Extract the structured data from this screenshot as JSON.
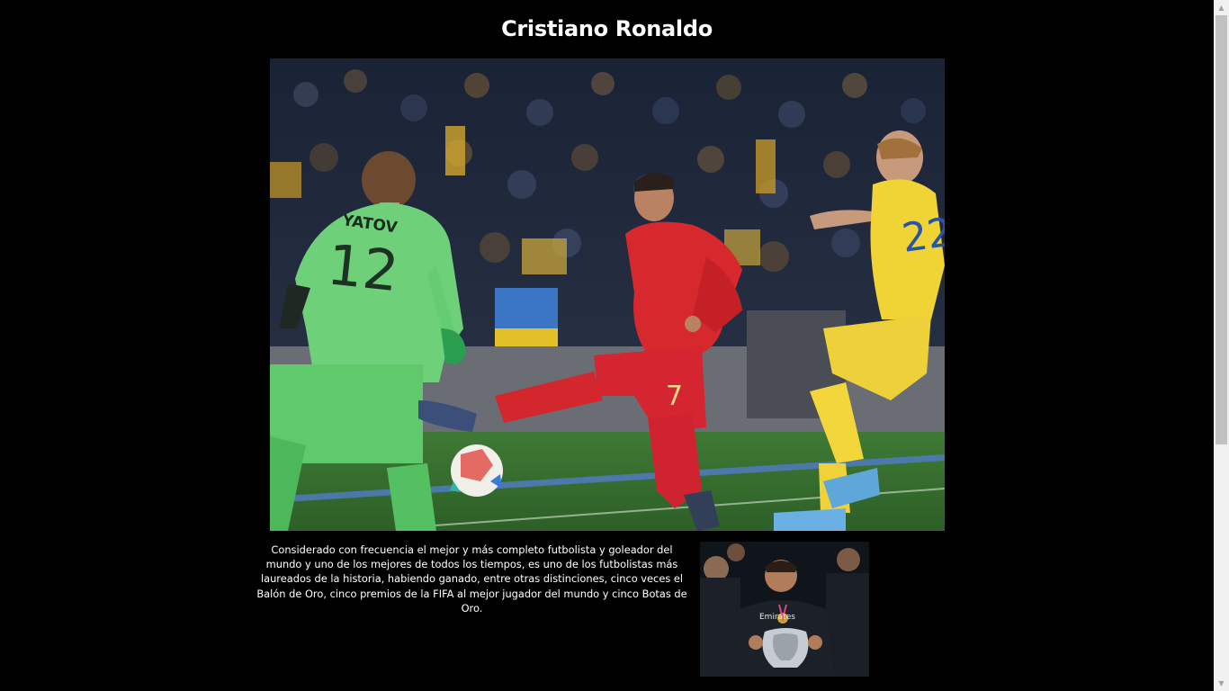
{
  "page": {
    "title": "Cristiano Ronaldo",
    "description": "Considerado con frecuencia el mejor y más completo futbolista y goleador del mundo y uno de los mejores de todos los tiempos, es uno de los futbolistas más laureados de la historia, habiendo ganado, entre otras distinciones, cinco veces el Balón de Oro, cinco premios de la FIFA al mejor jugador del mundo y cinco Botas de Oro."
  },
  "hero_image": {
    "goalkeeper_name": "YATOV",
    "goalkeeper_number": "12",
    "ronaldo_number": "7",
    "defender_number": "22"
  },
  "thumb_image": {
    "sponsor_text": "Emirates"
  },
  "scrollbar": {
    "up_arrow": "▲",
    "down_arrow": "▼"
  }
}
